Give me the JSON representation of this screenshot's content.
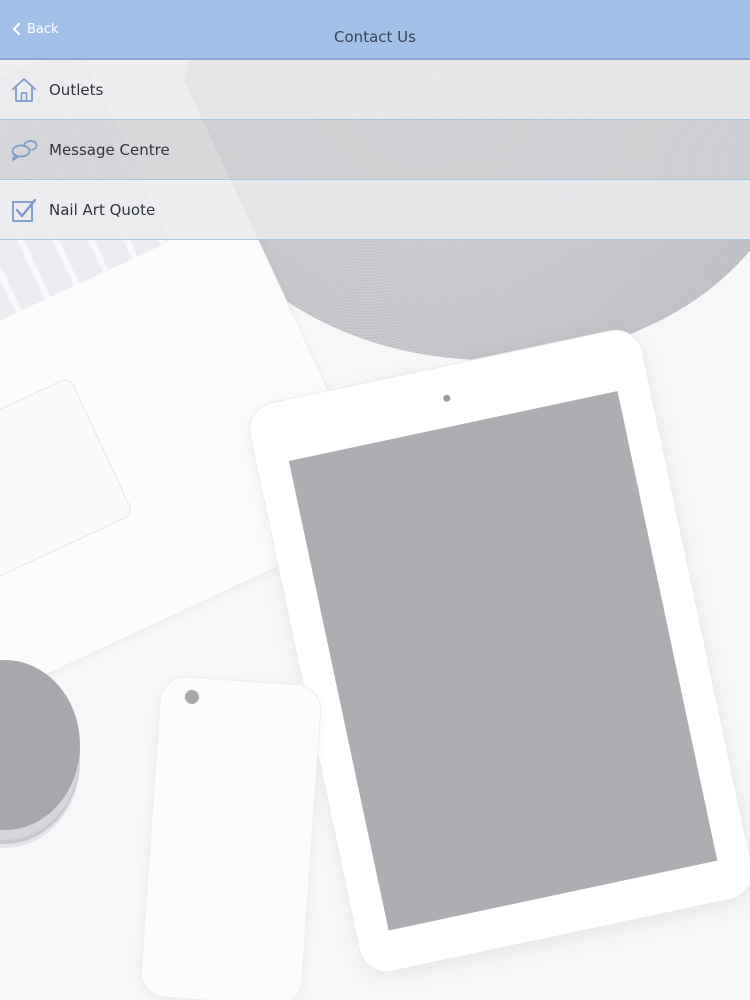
{
  "header": {
    "back_label": "Back",
    "title": "Contact Us"
  },
  "menu": {
    "items": [
      {
        "label": "Outlets",
        "icon": "home-icon"
      },
      {
        "label": "Message Centre",
        "icon": "chat-bubbles-icon"
      },
      {
        "label": "Nail Art Quote",
        "icon": "checkbox-icon"
      }
    ]
  },
  "colors": {
    "navbar": "#a3c0e9",
    "icon_accent": "#7e99c8",
    "divider": "#aec4e6"
  }
}
